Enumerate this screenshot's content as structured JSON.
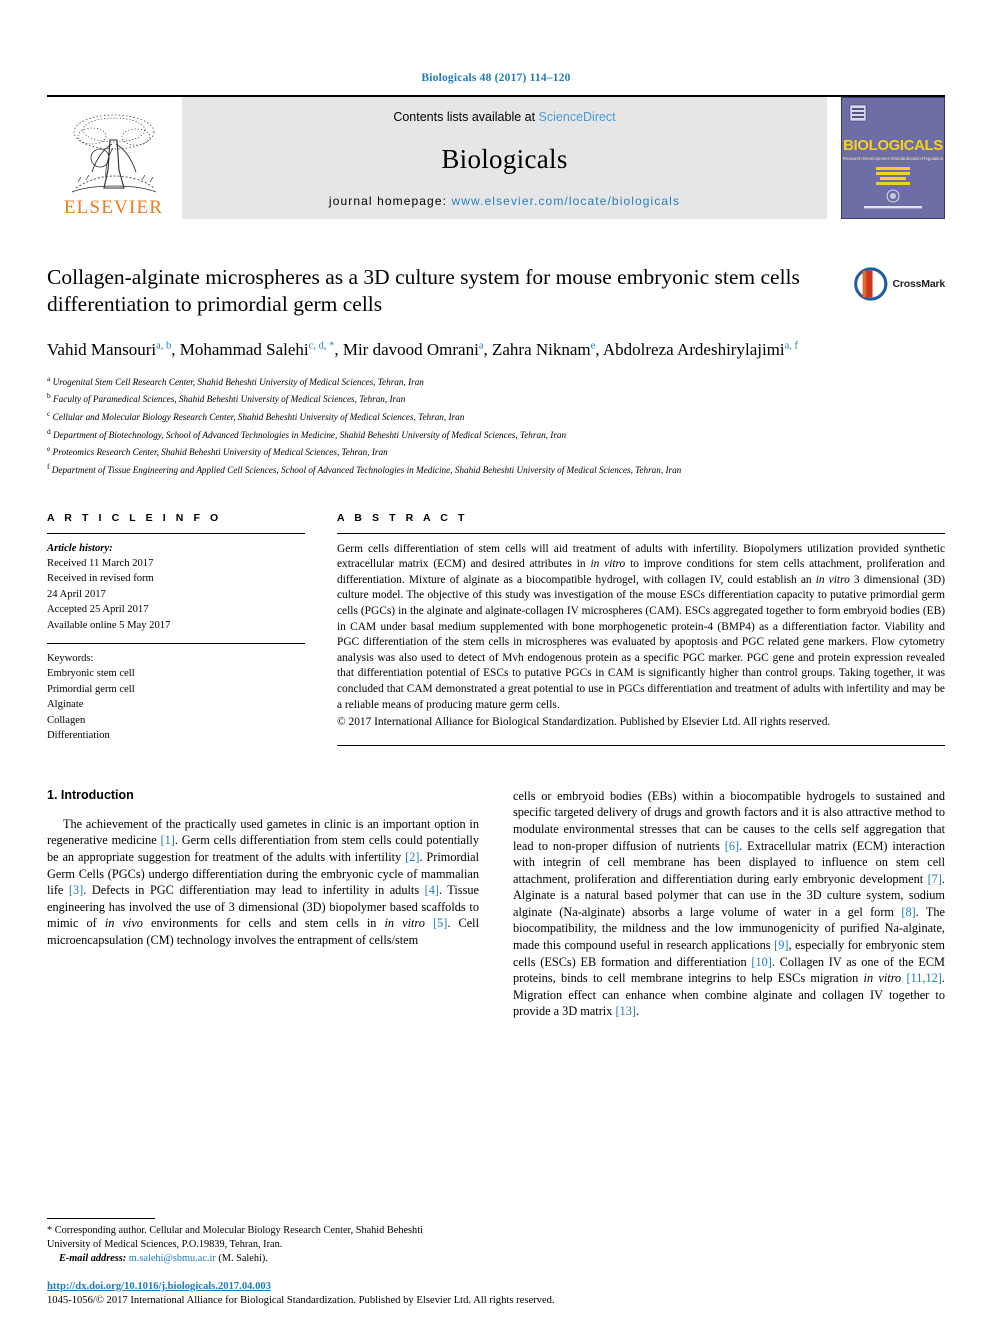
{
  "running_head": "Biologicals 48 (2017) 114–120",
  "masthead": {
    "publisher": "ELSEVIER",
    "contents_prefix": "Contents lists available at ",
    "contents_link": "ScienceDirect",
    "journal_name": "Biologicals",
    "homepage_prefix": "journal homepage: ",
    "homepage_url": "www.elsevier.com/locate/biologicals",
    "cover_title": "BIOLOGICALS",
    "cover_subtitle": "Research • Development • Standardization • Regulation"
  },
  "article": {
    "title": "Collagen-alginate microspheres as a 3D culture system for mouse embryonic stem cells differentiation to primordial germ cells",
    "crossmark_label": "CrossMark",
    "authors": [
      {
        "name": "Vahid Mansouri",
        "marks": "a, b",
        "sep": ", "
      },
      {
        "name": "Mohammad Salehi",
        "marks": "c, d, *",
        "sep": ", "
      },
      {
        "name": "Mir davood Omrani",
        "marks": "a",
        "sep": ", "
      },
      {
        "name": "Zahra Niknam",
        "marks": "e",
        "sep": ", "
      },
      {
        "name": "Abdolreza Ardeshirylajimi",
        "marks": "a, f",
        "sep": ""
      }
    ],
    "affiliations": [
      {
        "mark": "a",
        "text": "Urogenital Stem Cell Research Center, Shahid Beheshti University of Medical Sciences, Tehran, Iran"
      },
      {
        "mark": "b",
        "text": "Faculty of Paramedical Sciences, Shahid Beheshti University of Medical Sciences, Tehran, Iran"
      },
      {
        "mark": "c",
        "text": "Cellular and Molecular Biology Research Center, Shahid Beheshti University of Medical Sciences, Tehran, Iran"
      },
      {
        "mark": "d",
        "text": "Department of Biotechnology, School of Advanced Technologies in Medicine, Shahid Beheshti University of Medical Sciences, Tehran, Iran"
      },
      {
        "mark": "e",
        "text": "Proteomics Research Center, Shahid Beheshti University of Medical Sciences, Tehran, Iran"
      },
      {
        "mark": "f",
        "text": "Department of Tissue Engineering and Applied Cell Sciences, School of Advanced Technologies in Medicine, Shahid Beheshti University of Medical Sciences, Tehran, Iran"
      }
    ]
  },
  "article_info": {
    "heading": "A R T I C L E   I N F O",
    "history_label": "Article history:",
    "history": [
      "Received 11 March 2017",
      "Received in revised form",
      "24 April 2017",
      "Accepted 25 April 2017",
      "Available online 5 May 2017"
    ],
    "keywords_label": "Keywords:",
    "keywords": [
      "Embryonic stem cell",
      "Primordial germ cell",
      "Alginate",
      "Collagen",
      "Differentiation"
    ]
  },
  "abstract": {
    "heading": "A B S T R A C T",
    "text": "Germ cells differentiation of stem cells will aid treatment of adults with infertility. Biopolymers utilization provided synthetic extracellular matrix (ECM) and desired attributes in in vitro to improve conditions for stem cells attachment, proliferation and differentiation. Mixture of alginate as a biocompatible hydrogel, with collagen IV, could establish an in vitro 3 dimensional (3D) culture model. The objective of this study was investigation of the mouse ESCs differentiation capacity to putative primordial germ cells (PGCs) in the alginate and alginate-collagen IV microspheres (CAM). ESCs aggregated together to form embryoid bodies (EB) in CAM under basal medium supplemented with bone morphogenetic protein-4 (BMP4) as a differentiation factor. Viability and PGC differentiation of the stem cells in microspheres was evaluated by apoptosis and PGC related gene markers. Flow cytometry analysis was also used to detect of Mvh endogenous protein as a specific PGC marker. PGC gene and protein expression revealed that differentiation potential of ESCs to putative PGCs in CAM is significantly higher than control groups. Taking together, it was concluded that CAM demonstrated a great potential to use in PGCs differentiation and treatment of adults with infertility and may be a reliable means of producing mature germ cells.",
    "copyright": "© 2017 International Alliance for Biological Standardization. Published by Elsevier Ltd. All rights reserved."
  },
  "body": {
    "section_number_title": "1. Introduction",
    "left_paragraph": "The achievement of the practically used gametes in clinic is an important option in regenerative medicine [1]. Germ cells differentiation from stem cells could potentially be an appropriate suggestion for treatment of the adults with infertility [2]. Primordial Germ Cells (PGCs) undergo differentiation during the embryonic cycle of mammalian life [3]. Defects in PGC differentiation may lead to infertility in adults [4]. Tissue engineering has involved the use of 3 dimensional (3D) biopolymer based scaffolds to mimic of in vivo environments for cells and stem cells in in vitro [5]. Cell microencapsulation (CM) technology involves the entrapment of cells/stem",
    "right_paragraph": "cells or embryoid bodies (EBs) within a biocompatible hydrogels to sustained and specific targeted delivery of drugs and growth factors and it is also attractive method to modulate environmental stresses that can be causes to the cells self aggregation that lead to non-proper diffusion of nutrients [6]. Extracellular matrix (ECM) interaction with integrin of cell membrane has been displayed to influence on stem cell attachment, proliferation and differentiation during early embryonic development [7]. Alginate is a natural based polymer that can use in the 3D culture system, sodium alginate (Na-alginate) absorbs a large volume of water in a gel form [8]. The biocompatibility, the mildness and the low immunogenicity of purified Na-alginate, made this compound useful in research applications [9], especially for embryonic stem cells (ESCs) EB formation and differentiation [10]. Collagen IV as one of the ECM proteins, binds to cell membrane integrins to help ESCs migration in vitro [11,12]. Migration effect can enhance when combine alginate and collagen IV together to provide a 3D matrix [13]."
  },
  "footnotes": {
    "corresponding_marker": "*",
    "corresponding_text": "Corresponding author. Cellular and Molecular Biology Research Center, Shahid Beheshti University of Medical Sciences, P.O.19839, Tehran, Iran.",
    "email_label": "E-mail address:",
    "email": "m.salehi@sbmu.ac.ir",
    "email_owner": "(M. Salehi)."
  },
  "doi_block": {
    "doi_url": "http://dx.doi.org/10.1016/j.biologicals.2017.04.003",
    "issn_line": "1045-1056/© 2017 International Alliance for Biological Standardization. Published by Elsevier Ltd. All rights reserved."
  },
  "colors": {
    "link_blue": "#1f7bb6",
    "elsevier_orange": "#ef7c1a",
    "masthead_gray": "#e6e6e6",
    "cover_purple": "#6d6ea6",
    "cover_yellow": "#f5d020"
  }
}
